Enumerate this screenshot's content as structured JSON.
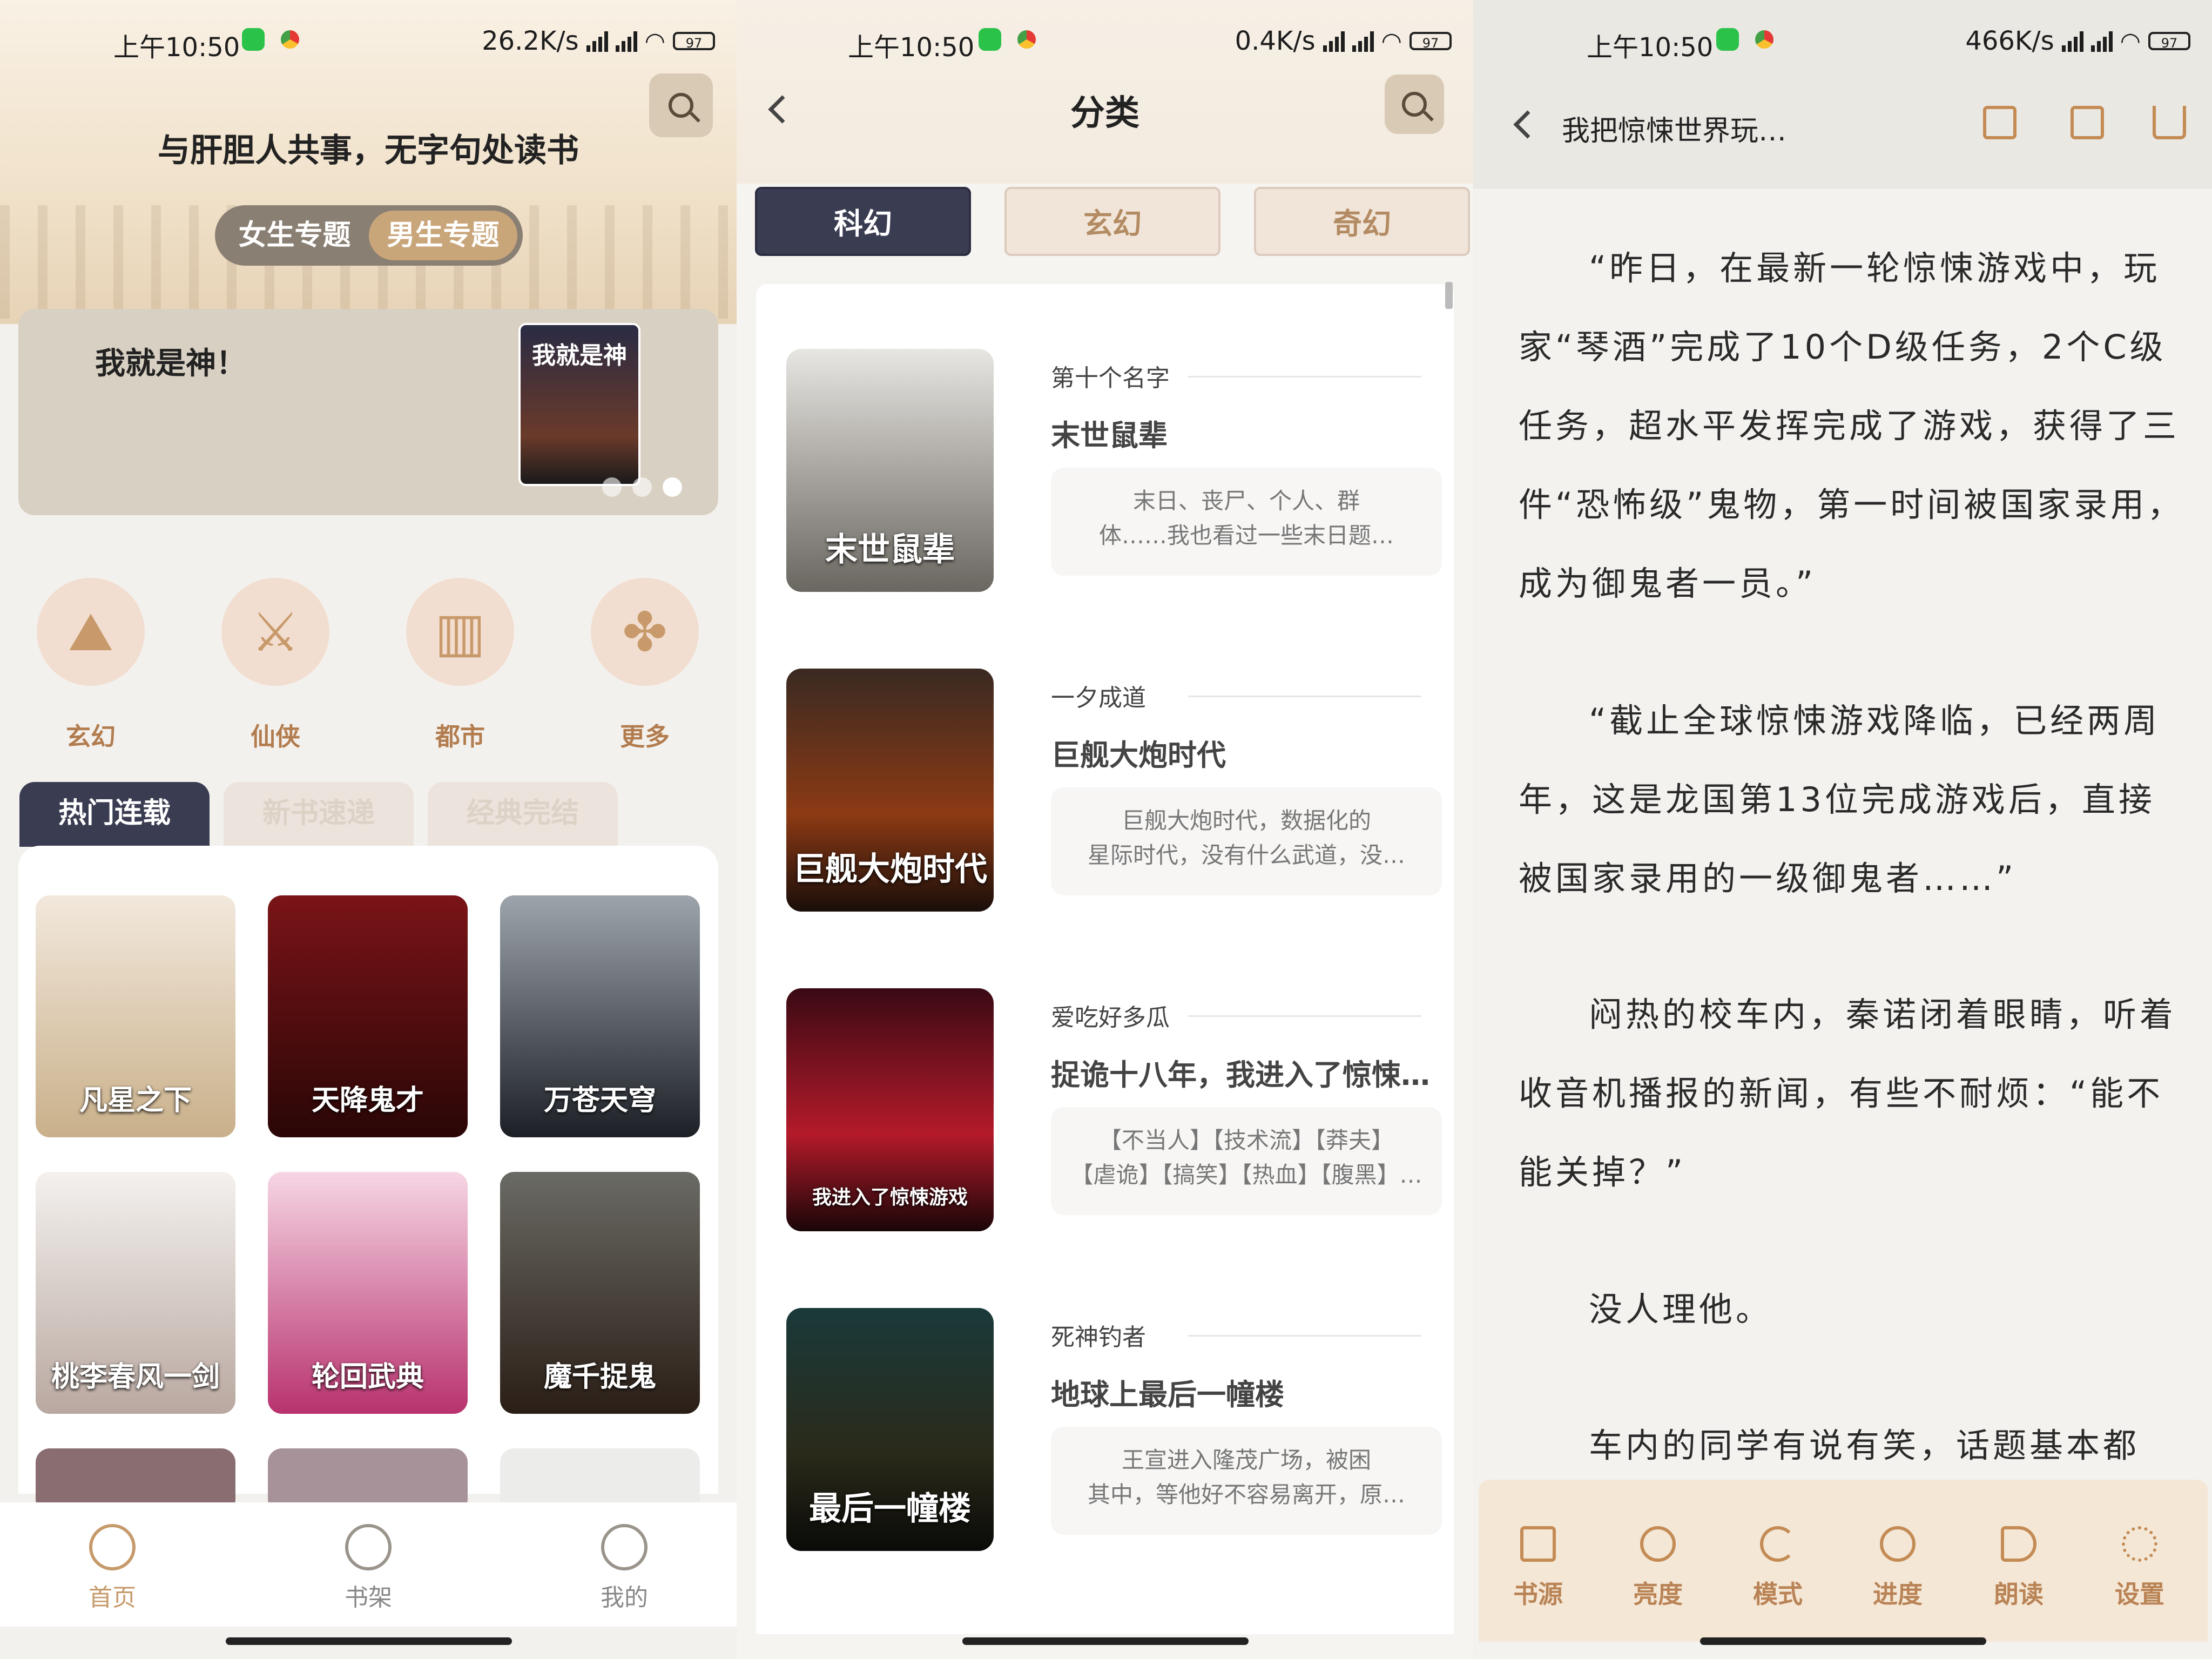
{
  "status_bars": [
    {
      "time": "上午10:50",
      "speed": "26.2K/s",
      "battery": "97"
    },
    {
      "time": "上午10:50",
      "speed": "0.4K/s",
      "battery": "97"
    },
    {
      "time": "上午10:50",
      "speed": "466K/s",
      "battery": "97"
    }
  ],
  "home": {
    "slogan": "与肝胆人共事，无字句处读书",
    "topics": [
      "女生专题",
      "男生专题"
    ],
    "banner": {
      "title": "我就是神！",
      "cover_text": "我就是神"
    },
    "categories": [
      "玄幻",
      "仙侠",
      "都市",
      "更多"
    ],
    "tabs": [
      "热门连载",
      "新书速递",
      "经典完结"
    ],
    "books": [
      "凡星之下",
      "天降鬼才",
      "万苍天穹",
      "桃李春风一剑",
      "轮回武典",
      "魔千捉鬼"
    ],
    "bottom_nav": [
      "首页",
      "书架",
      "我的"
    ]
  },
  "category": {
    "title": "分类",
    "tabs": [
      "科幻",
      "玄幻",
      "奇幻"
    ],
    "books": [
      {
        "author": "第十个名字",
        "title": "末世鼠辈",
        "desc1": "末日、丧尸、个人、群",
        "desc2": "体……我也看过一些末日题…",
        "cover": "末世鼠辈"
      },
      {
        "author": "一夕成道",
        "title": "巨舰大炮时代",
        "desc1": "巨舰大炮时代，数据化的",
        "desc2": "星际时代，没有什么武道，没…",
        "cover": "巨舰大炮时代"
      },
      {
        "author": "爱吃好多瓜",
        "title": "捉诡十八年，我进入了惊悚…",
        "desc1": "【不当人】【技术流】【莽夫】",
        "desc2": "【虐诡】【搞笑】【热血】【腹黑】…",
        "cover": "我进入了惊悚游戏"
      },
      {
        "author": "死神钓者",
        "title": "地球上最后一幢楼",
        "desc1": "王宣进入隆茂广场，被困",
        "desc2": "其中，等他好不容易离开，原…",
        "cover": "最后一幢楼"
      }
    ]
  },
  "reader": {
    "book_title": "我把惊悚世界玩…",
    "paragraphs": [
      "“昨日，在最新一轮惊悚游戏中，玩家“琴酒”完成了10个D级任务，2个C级任务，超水平发挥完成了游戏，获得了三件“恐怖级”鬼物，第一时间被国家录用，成为御鬼者一员。”",
      "“截止全球惊悚游戏降临，已经两周年，这是龙国第13位完成游戏后，直接被国家录用的一级御鬼者……”",
      "闷热的校车内，秦诺闭着眼睛，听着收音机播报的新闻，有些不耐烦：“能不能关掉？”",
      "没人理他。",
      "车内的同学有说有笑，话题基本都"
    ],
    "toolbar": [
      "书源",
      "亮度",
      "模式",
      "进度",
      "朗读",
      "设置"
    ]
  },
  "colors": {
    "accent": "#c69a6b",
    "dark_tab": "#3a3c52"
  }
}
